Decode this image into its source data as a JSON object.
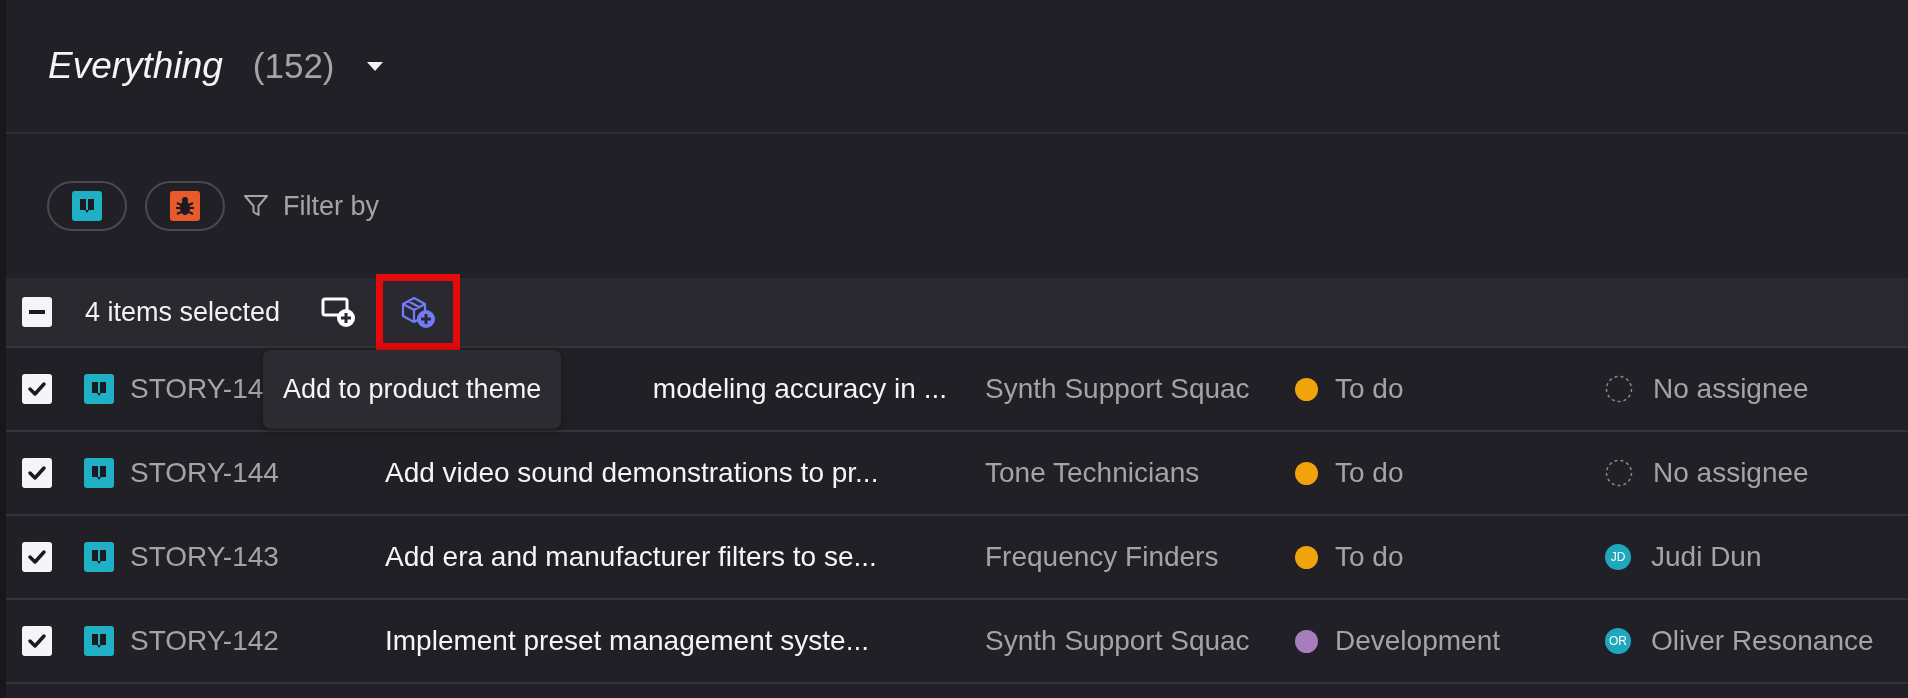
{
  "view": {
    "title": "Everything",
    "count": "(152)"
  },
  "filters": {
    "types": [
      {
        "kind": "story"
      },
      {
        "kind": "bug"
      }
    ],
    "label": "Filter by"
  },
  "selection": {
    "indeterminate": true,
    "label": "4 items selected",
    "actions": [
      {
        "kind": "screen-add",
        "highlighted": false
      },
      {
        "kind": "box-add",
        "highlighted": true
      }
    ]
  },
  "tooltip": "Add to product theme",
  "rows": [
    {
      "checked": true,
      "kind": "story",
      "id": "STORY-14",
      "title": "modeling accuracy in ...",
      "title_covered": true,
      "team": "Synth Support Squac",
      "status": "To do",
      "color": "#f0a30a",
      "assignee": {
        "kind": "none",
        "name": "No assignee"
      }
    },
    {
      "checked": true,
      "kind": "story",
      "id": "STORY-144",
      "title": "Add video sound demonstrations to pr...",
      "title_covered": false,
      "team": "Tone Technicians",
      "status": "To do",
      "color": "#f0a30a",
      "assignee": {
        "kind": "none",
        "name": "No assignee"
      }
    },
    {
      "checked": true,
      "kind": "story",
      "id": "STORY-143",
      "title": "Add era and manufacturer filters to se...",
      "title_covered": false,
      "team": "Frequency Finders",
      "status": "To do",
      "color": "#f0a30a",
      "assignee": {
        "kind": "person",
        "initials": "JD",
        "name": "Judi Dun"
      }
    },
    {
      "checked": true,
      "kind": "story",
      "id": "STORY-142",
      "title": "Implement preset management syste...",
      "title_covered": false,
      "team": "Synth Support Squac",
      "status": "Development",
      "color": "#a77dbd",
      "assignee": {
        "kind": "person",
        "initials": "OR",
        "name": "Oliver Resonance"
      }
    }
  ]
}
